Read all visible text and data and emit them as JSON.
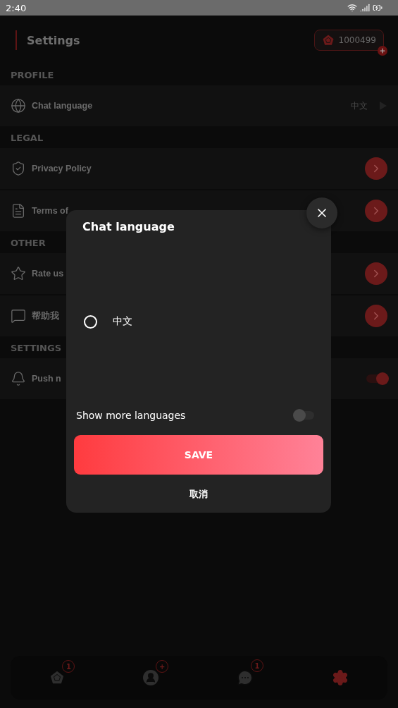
{
  "status_bar": {
    "time": "2:40"
  },
  "header": {
    "title": "Settings",
    "coins": "1000499"
  },
  "sections": [
    {
      "title": "PROFILE",
      "items": [
        {
          "kind": "value",
          "label": "Chat language",
          "value": "中文"
        }
      ]
    },
    {
      "title": "LEGAL",
      "items": [
        {
          "kind": "link",
          "label": "Privacy Policy"
        },
        {
          "kind": "link",
          "label": "Terms of"
        }
      ]
    },
    {
      "title": "OTHER",
      "items": [
        {
          "kind": "link",
          "label": "Rate us"
        },
        {
          "kind": "link",
          "label": "帮助我"
        }
      ]
    },
    {
      "title": "SETTINGS",
      "items": [
        {
          "kind": "toggle",
          "label": "Push n",
          "on": true
        }
      ]
    }
  ],
  "dialog": {
    "title": "Chat language",
    "options": [
      {
        "label": "中文",
        "selected": false
      }
    ],
    "show_more": {
      "label": "Show more languages",
      "on": false
    },
    "save": "SAVE",
    "cancel": "取消"
  },
  "bottom_nav": [
    {
      "badge": "1",
      "selected": false
    },
    {
      "badge": "+",
      "selected": false
    },
    {
      "badge": "1",
      "selected": false
    },
    {
      "selected": true
    }
  ]
}
